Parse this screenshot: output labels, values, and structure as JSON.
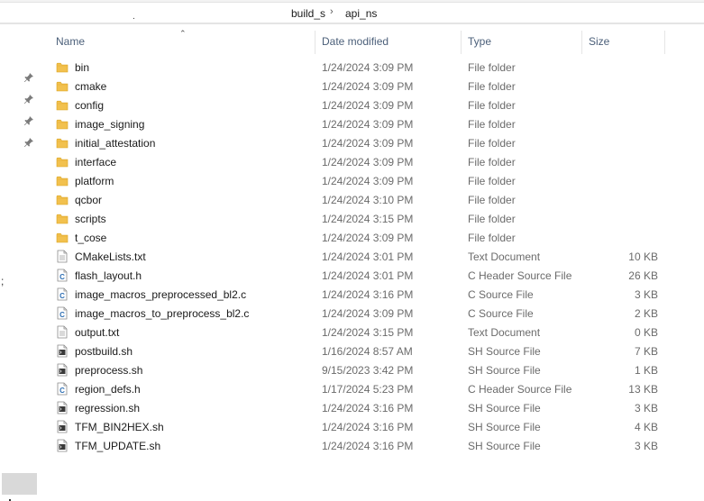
{
  "breadcrumb": {
    "segments": [
      "build_s",
      "api_ns"
    ],
    "separator": "›"
  },
  "nav": {
    "pinned_count": 4
  },
  "columns": {
    "name": "Name",
    "date": "Date modified",
    "type": "Type",
    "size": "Size"
  },
  "files": [
    {
      "name": "bin",
      "date": "1/24/2024 3:09 PM",
      "type": "File folder",
      "size": "",
      "icon": "folder-icon"
    },
    {
      "name": "cmake",
      "date": "1/24/2024 3:09 PM",
      "type": "File folder",
      "size": "",
      "icon": "folder-icon"
    },
    {
      "name": "config",
      "date": "1/24/2024 3:09 PM",
      "type": "File folder",
      "size": "",
      "icon": "folder-icon"
    },
    {
      "name": "image_signing",
      "date": "1/24/2024 3:09 PM",
      "type": "File folder",
      "size": "",
      "icon": "folder-icon"
    },
    {
      "name": "initial_attestation",
      "date": "1/24/2024 3:09 PM",
      "type": "File folder",
      "size": "",
      "icon": "folder-icon"
    },
    {
      "name": "interface",
      "date": "1/24/2024 3:09 PM",
      "type": "File folder",
      "size": "",
      "icon": "folder-icon"
    },
    {
      "name": "platform",
      "date": "1/24/2024 3:09 PM",
      "type": "File folder",
      "size": "",
      "icon": "folder-icon"
    },
    {
      "name": "qcbor",
      "date": "1/24/2024 3:10 PM",
      "type": "File folder",
      "size": "",
      "icon": "folder-icon"
    },
    {
      "name": "scripts",
      "date": "1/24/2024 3:15 PM",
      "type": "File folder",
      "size": "",
      "icon": "folder-icon"
    },
    {
      "name": "t_cose",
      "date": "1/24/2024 3:09 PM",
      "type": "File folder",
      "size": "",
      "icon": "folder-icon"
    },
    {
      "name": "CMakeLists.txt",
      "date": "1/24/2024 3:01 PM",
      "type": "Text Document",
      "size": "10 KB",
      "icon": "text-file-icon"
    },
    {
      "name": "flash_layout.h",
      "date": "1/24/2024 3:01 PM",
      "type": "C Header Source File",
      "size": "26 KB",
      "icon": "c-file-icon"
    },
    {
      "name": "image_macros_preprocessed_bl2.c",
      "date": "1/24/2024 3:16 PM",
      "type": "C Source File",
      "size": "3 KB",
      "icon": "c-file-icon"
    },
    {
      "name": "image_macros_to_preprocess_bl2.c",
      "date": "1/24/2024 3:09 PM",
      "type": "C Source File",
      "size": "2 KB",
      "icon": "c-file-icon"
    },
    {
      "name": "output.txt",
      "date": "1/24/2024 3:15 PM",
      "type": "Text Document",
      "size": "0 KB",
      "icon": "text-file-icon"
    },
    {
      "name": "postbuild.sh",
      "date": "1/16/2024 8:57 AM",
      "type": "SH Source File",
      "size": "7 KB",
      "icon": "sh-file-icon"
    },
    {
      "name": "preprocess.sh",
      "date": "9/15/2023 3:42 PM",
      "type": "SH Source File",
      "size": "1 KB",
      "icon": "sh-file-icon"
    },
    {
      "name": "region_defs.h",
      "date": "1/17/2024 5:23 PM",
      "type": "C Header Source File",
      "size": "13 KB",
      "icon": "c-file-icon"
    },
    {
      "name": "regression.sh",
      "date": "1/24/2024 3:16 PM",
      "type": "SH Source File",
      "size": "3 KB",
      "icon": "sh-file-icon"
    },
    {
      "name": "TFM_BIN2HEX.sh",
      "date": "1/24/2024 3:16 PM",
      "type": "SH Source File",
      "size": "4 KB",
      "icon": "sh-file-icon"
    },
    {
      "name": "TFM_UPDATE.sh",
      "date": "1/24/2024 3:16 PM",
      "type": "SH Source File",
      "size": "3 KB",
      "icon": "sh-file-icon"
    }
  ],
  "colors": {
    "folder": "#f2c14e",
    "folder_dark": "#d9a21f",
    "header_text": "#4c607a",
    "c_file_accent": "#2f6fb3",
    "sh_file_dark": "#3a3a3a"
  }
}
